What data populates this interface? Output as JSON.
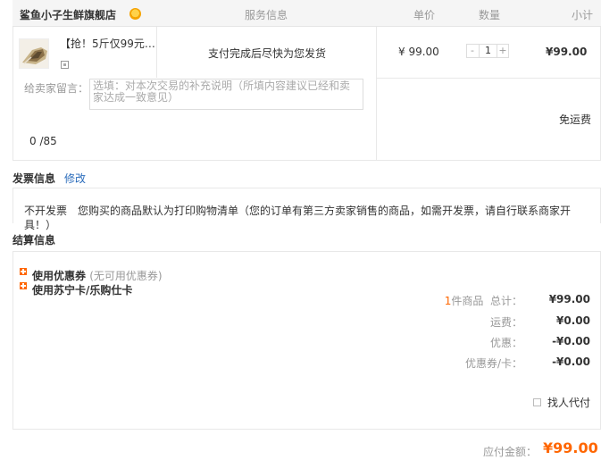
{
  "order": {
    "store_name": "鲨鱼小子生鲜旗舰店",
    "columns": {
      "service": "服务信息",
      "unit_price": "单价",
      "quantity": "数量",
      "subtotal": "小计"
    }
  },
  "item": {
    "title": "【抢！5斤仅99元…",
    "ship_note": "支付完成后尽快为您发货",
    "unit_price": "¥ 99.00",
    "quantity": "1",
    "qty_minus": "-",
    "qty_plus": "+",
    "subtotal": "¥99.00",
    "message_label": "给卖家留言：",
    "message_placeholder": "选填：对本次交易的补充说明（所填内容建议已经和卖家达成一致意见）",
    "char_count": "0 /85",
    "shipping": "免运费"
  },
  "invoice": {
    "title": "发票信息",
    "edit": "修改",
    "text": "不开发票　您购买的商品默认为打印购物清单（您的订单有第三方卖家销售的商品，如需开发票，请自行联系商家开具！）"
  },
  "settlement": {
    "title": "结算信息",
    "coupon_label": "使用优惠券",
    "coupon_note": "(无可用优惠券)",
    "card_label": "使用苏宁卡/乐购仕卡",
    "items_count": "1",
    "items_suffix": "件商品",
    "total_label": "总计：",
    "total_value": "¥99.00",
    "freight_label": "运费：",
    "freight_value": "¥0.00",
    "discount_label": "优惠：",
    "discount_value": "-¥0.00",
    "coupon_card_label": "优惠券/卡：",
    "coupon_card_value": "-¥0.00",
    "agent_pay": "找人代付",
    "payable_label": "应付金额：",
    "payable_value": "¥99.00"
  },
  "colors": {
    "accent": "#ff6600",
    "link": "#2c6dbc",
    "border": "#e8e8e8",
    "header_bg": "#f5f5f5"
  }
}
